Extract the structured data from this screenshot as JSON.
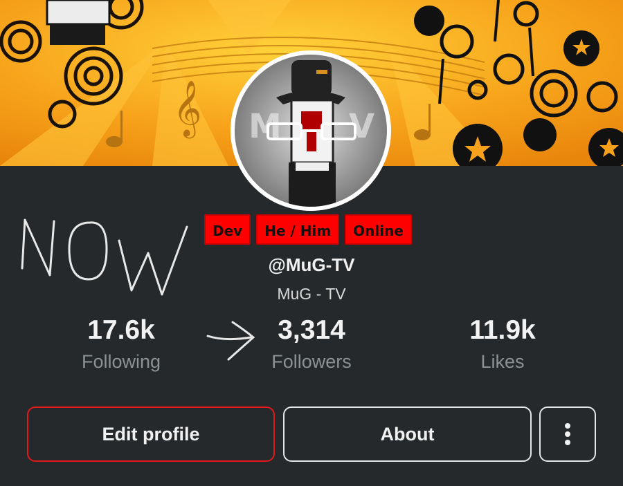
{
  "colors": {
    "background": "#25292b",
    "banner_orange": "#f7a21a",
    "badge_red": "#ff0000",
    "edit_border": "#e01a1a",
    "muted_text": "#8c9194"
  },
  "banner": {
    "icon": "orange-music-swirl-banner"
  },
  "avatar": {
    "icon": "avatar-character-with-hat-and-glasses"
  },
  "annotation": {
    "text": "NOW",
    "arrow_icon": "hand-drawn-arrow-icon"
  },
  "badges": [
    "Dev",
    "He / Him",
    "Online"
  ],
  "profile": {
    "handle": "@MuG-TV",
    "display_name": "MuG - TV"
  },
  "stats": [
    {
      "value": "17.6k",
      "label": "Following"
    },
    {
      "value": "3,314",
      "label": "Followers"
    },
    {
      "value": "11.9k",
      "label": "Likes"
    }
  ],
  "actions": {
    "edit_label": "Edit profile",
    "about_label": "About",
    "more_icon": "more-vertical-icon"
  }
}
